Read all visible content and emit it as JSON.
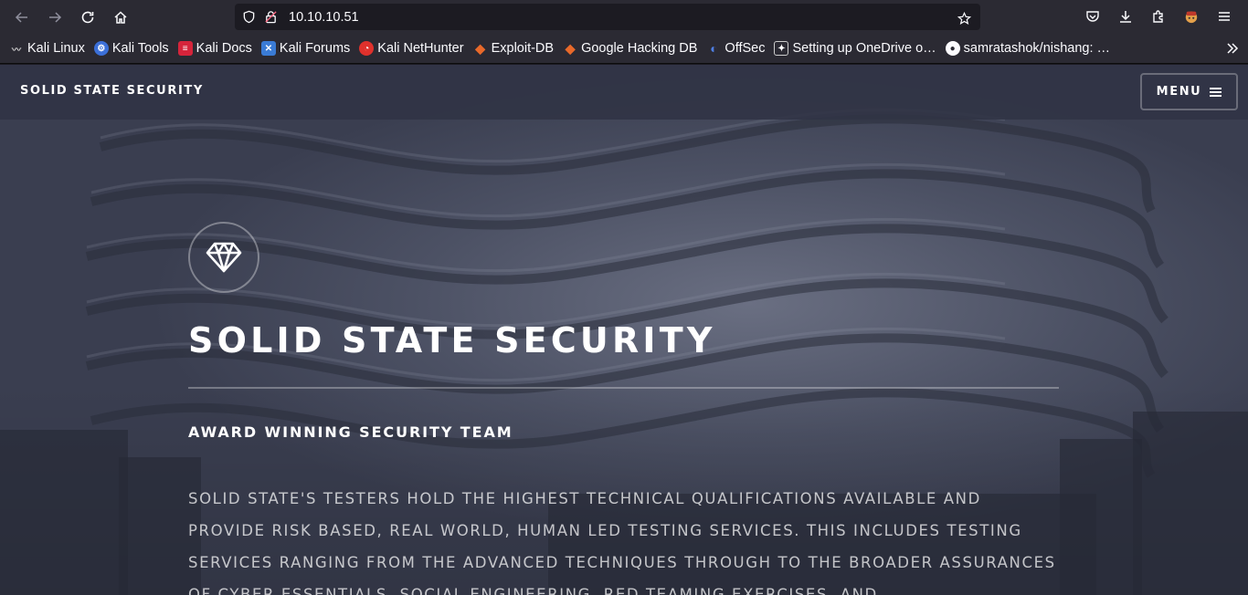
{
  "browser": {
    "url": "10.10.10.51",
    "bookmarks": [
      {
        "label": "Kali Linux",
        "icon": "kali-dragon-icon",
        "color": "#1b1b1b"
      },
      {
        "label": "Kali Tools",
        "icon": "kali-tools-icon",
        "color": "#3b6fd8"
      },
      {
        "label": "Kali Docs",
        "icon": "kali-docs-icon",
        "color": "#d6243b"
      },
      {
        "label": "Kali Forums",
        "icon": "kali-forums-icon",
        "color": "#3a7bd5"
      },
      {
        "label": "Kali NetHunter",
        "icon": "kali-nethunter-icon",
        "color": "#e0312c"
      },
      {
        "label": "Exploit-DB",
        "icon": "exploit-db-icon",
        "color": "#e8692a"
      },
      {
        "label": "Google Hacking DB",
        "icon": "ghdb-icon",
        "color": "#e8692a"
      },
      {
        "label": "OffSec",
        "icon": "offsec-icon",
        "color": "#4f7fe3"
      },
      {
        "label": "Setting up OneDrive o…",
        "icon": "onedrive-doc-icon",
        "color": "#2b2a33"
      },
      {
        "label": "samratashok/nishang: …",
        "icon": "github-icon",
        "color": "#2b2a33"
      }
    ]
  },
  "site": {
    "logo": "SOLID STATE SECURITY",
    "menu_label": "MENU",
    "banner_title": "SOLID STATE SECURITY",
    "banner_subtitle": "AWARD WINNING SECURITY TEAM",
    "banner_body": "Solid State's testers hold the highest technical qualifications available and provide risk based, real world, human led testing services. This includes testing services ranging from the advanced techniques through to the broader assurances of Cyber Essentials, social engineering, red teaming exercises, and"
  }
}
